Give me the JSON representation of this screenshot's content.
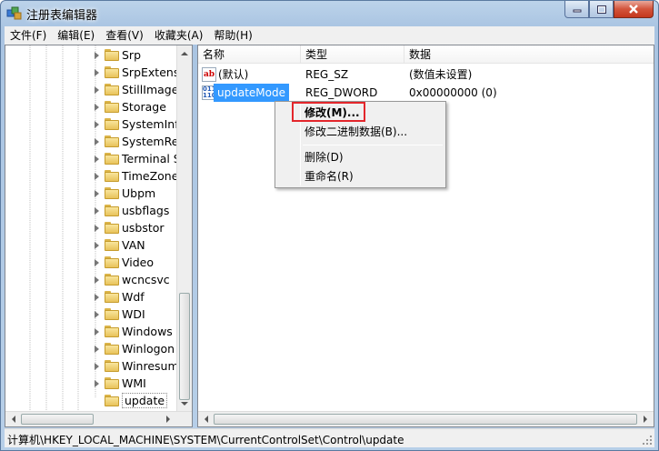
{
  "window": {
    "title": "注册表编辑器"
  },
  "menubar": {
    "items": [
      "文件(F)",
      "编辑(E)",
      "查看(V)",
      "收藏夹(A)",
      "帮助(H)"
    ]
  },
  "tree": {
    "items": [
      {
        "label": "Srp"
      },
      {
        "label": "SrpExtensio"
      },
      {
        "label": "StillImage"
      },
      {
        "label": "Storage"
      },
      {
        "label": "SystemInfo"
      },
      {
        "label": "SystemReso"
      },
      {
        "label": "Terminal Se"
      },
      {
        "label": "TimeZoneIn"
      },
      {
        "label": "Ubpm"
      },
      {
        "label": "usbflags"
      },
      {
        "label": "usbstor"
      },
      {
        "label": "VAN"
      },
      {
        "label": "Video"
      },
      {
        "label": "wcncsvc"
      },
      {
        "label": "Wdf"
      },
      {
        "label": "WDI"
      },
      {
        "label": "Windows"
      },
      {
        "label": "Winlogon"
      },
      {
        "label": "Winresume"
      },
      {
        "label": "WMI"
      },
      {
        "label": "update"
      }
    ]
  },
  "list": {
    "columns": [
      "名称",
      "类型",
      "数据"
    ],
    "rows": [
      {
        "name": "(默认)",
        "type": "REG_SZ",
        "data": "(数值未设置)",
        "icon": "string-value-icon"
      },
      {
        "name": "updateMode",
        "type": "REG_DWORD",
        "data": "0x00000000 (0)",
        "icon": "binary-value-icon"
      }
    ]
  },
  "context_menu": {
    "modify": "修改(M)...",
    "modify_binary": "修改二进制数据(B)...",
    "delete": "删除(D)",
    "rename": "重命名(R)"
  },
  "status": {
    "path": "计算机\\HKEY_LOCAL_MACHINE\\SYSTEM\\CurrentControlSet\\Control\\update"
  },
  "colors": {
    "selection": "#3399ff",
    "highlight_box": "#e3262b",
    "title_bg": "#bcd3ea"
  }
}
